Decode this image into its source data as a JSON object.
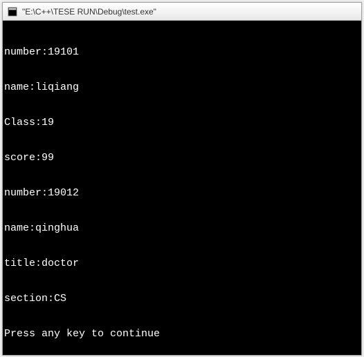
{
  "window": {
    "title": "\"E:\\C++\\TESE RUN\\Debug\\test.exe\""
  },
  "output": {
    "lines": [
      "number:19101",
      "name:liqiang",
      "Class:19",
      "score:99",
      "number:19012",
      "name:qinghua",
      "title:doctor",
      "section:CS",
      "Press any key to continue"
    ]
  }
}
